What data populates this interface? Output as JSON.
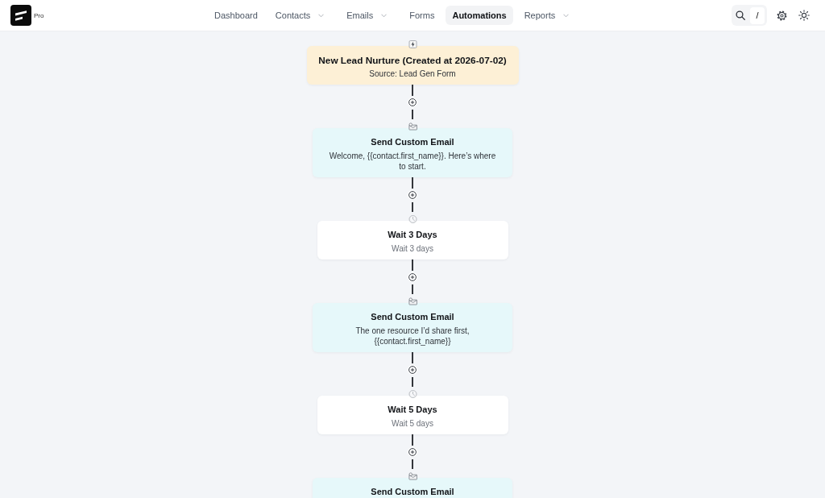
{
  "header": {
    "logo_badge": "Pro",
    "nav": [
      {
        "label": "Dashboard",
        "selected": false,
        "dropdown": false
      },
      {
        "label": "Contacts",
        "selected": false,
        "dropdown": true
      },
      {
        "label": "Emails",
        "selected": false,
        "dropdown": true
      },
      {
        "label": "Forms",
        "selected": false,
        "dropdown": false
      },
      {
        "label": "Automations",
        "selected": true,
        "dropdown": false
      },
      {
        "label": "Reports",
        "selected": false,
        "dropdown": true
      }
    ],
    "search_shortcut": "/"
  },
  "workflow": {
    "steps": [
      {
        "kind": "trigger",
        "title": "New Lead Nurture (Created at 2026-07-02)",
        "subtitle": "Source: Lead Gen Form"
      },
      {
        "kind": "email",
        "title": "Send Custom Email",
        "subtitle": "Welcome, {{contact.first_name}}. Here’s where to start."
      },
      {
        "kind": "wait",
        "title": "Wait 3 Days",
        "subtitle": "Wait 3 days"
      },
      {
        "kind": "email",
        "title": "Send Custom Email",
        "subtitle": "The one resource I’d share first, {{contact.first_name}}"
      },
      {
        "kind": "wait",
        "title": "Wait 5 Days",
        "subtitle": "Wait 5 days"
      },
      {
        "kind": "email",
        "title": "Send Custom Email"
      }
    ]
  }
}
